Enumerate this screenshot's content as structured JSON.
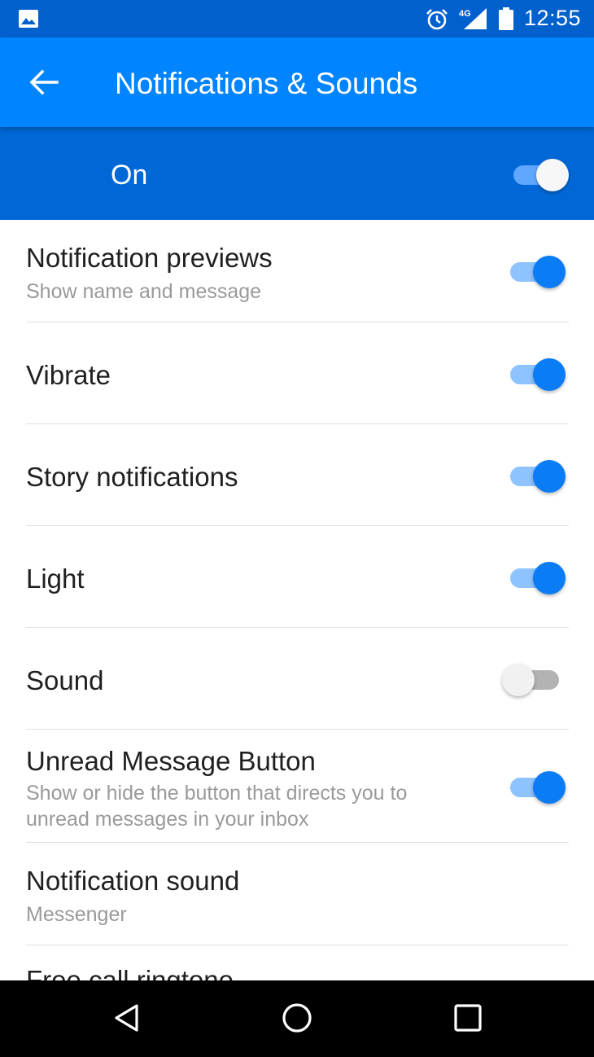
{
  "status_bar": {
    "time": "12:55",
    "network": "4G"
  },
  "app_bar": {
    "title": "Notifications & Sounds"
  },
  "master": {
    "label": "On",
    "enabled": true
  },
  "settings": [
    {
      "title": "Notification previews",
      "subtitle": "Show name and message",
      "enabled": true
    },
    {
      "title": "Vibrate",
      "enabled": true
    },
    {
      "title": "Story notifications",
      "enabled": true
    },
    {
      "title": "Light",
      "enabled": true
    },
    {
      "title": "Sound",
      "enabled": false
    },
    {
      "title": "Unread Message Button",
      "subtitle_line1": "Show or hide the button that directs you to",
      "subtitle_line2": "unread messages in your inbox",
      "enabled": true
    },
    {
      "title": "Notification sound",
      "subtitle": "Messenger"
    },
    {
      "title": "Free call ringtone"
    }
  ],
  "colors": {
    "accent": "#0084ff",
    "accent_dark": "#0060cc",
    "switch_on": "#0a7cf5"
  }
}
